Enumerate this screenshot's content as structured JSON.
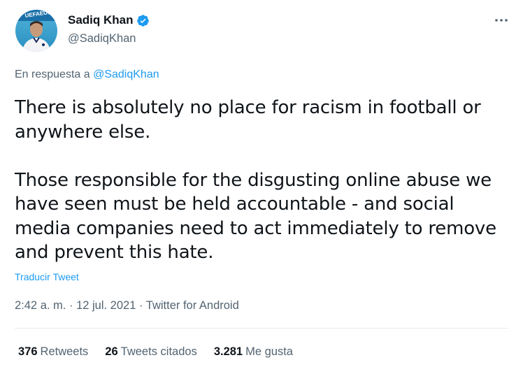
{
  "author": {
    "name": "Sadiq Khan",
    "handle": "@SadiqKhan",
    "verified": true,
    "avatar_banner_text": "UEFAEURO"
  },
  "reply_context": {
    "prefix": "En respuesta a",
    "handle": "@SadiqKhan"
  },
  "tweet": {
    "paragraphs": [
      "There is absolutely no place for racism in football or anywhere else.",
      "Those responsible for the disgusting online abuse we have seen must be held accountable - and social media companies need to act immediately to remove and prevent this hate."
    ],
    "translate_label": "Traducir Tweet",
    "time": "2:42 a. m.",
    "separator": "·",
    "date": "12 jul. 2021",
    "source": "Twitter for Android"
  },
  "stats": {
    "retweets": {
      "count": "376",
      "label": "Retweets"
    },
    "quotes": {
      "count": "26",
      "label": "Tweets citados"
    },
    "likes": {
      "count": "3.281",
      "label": "Me gusta"
    }
  },
  "colors": {
    "text": "#0f1419",
    "secondary": "#536471",
    "link": "#1d9bf0",
    "divider": "#e6ecf0"
  },
  "icons": [
    "verified-badge-icon",
    "more-icon"
  ]
}
